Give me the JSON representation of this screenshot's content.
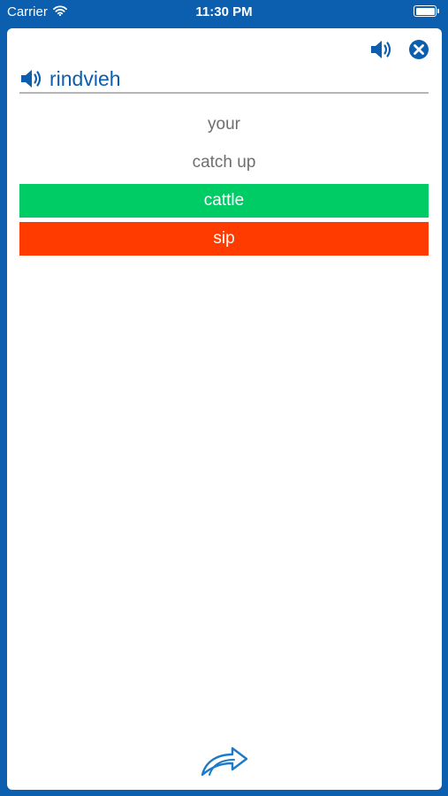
{
  "status_bar": {
    "carrier": "Carrier",
    "time": "11:30 PM",
    "battery_level": 1.0
  },
  "quiz": {
    "word": "rindvieh",
    "options": [
      {
        "label": "your",
        "state": "neutral"
      },
      {
        "label": "catch up",
        "state": "neutral"
      },
      {
        "label": "cattle",
        "state": "correct"
      },
      {
        "label": "sip",
        "state": "wrong"
      }
    ]
  },
  "icons": {
    "speaker": "speaker-icon",
    "close": "close-icon",
    "next": "forward-arrow-icon",
    "wifi": "wifi-icon",
    "battery": "battery-icon"
  },
  "colors": {
    "brand_blue": "#0b5fae",
    "correct_green": "#00cc66",
    "wrong_red": "#ff3b00",
    "neutral_text": "#6e6e6e"
  }
}
